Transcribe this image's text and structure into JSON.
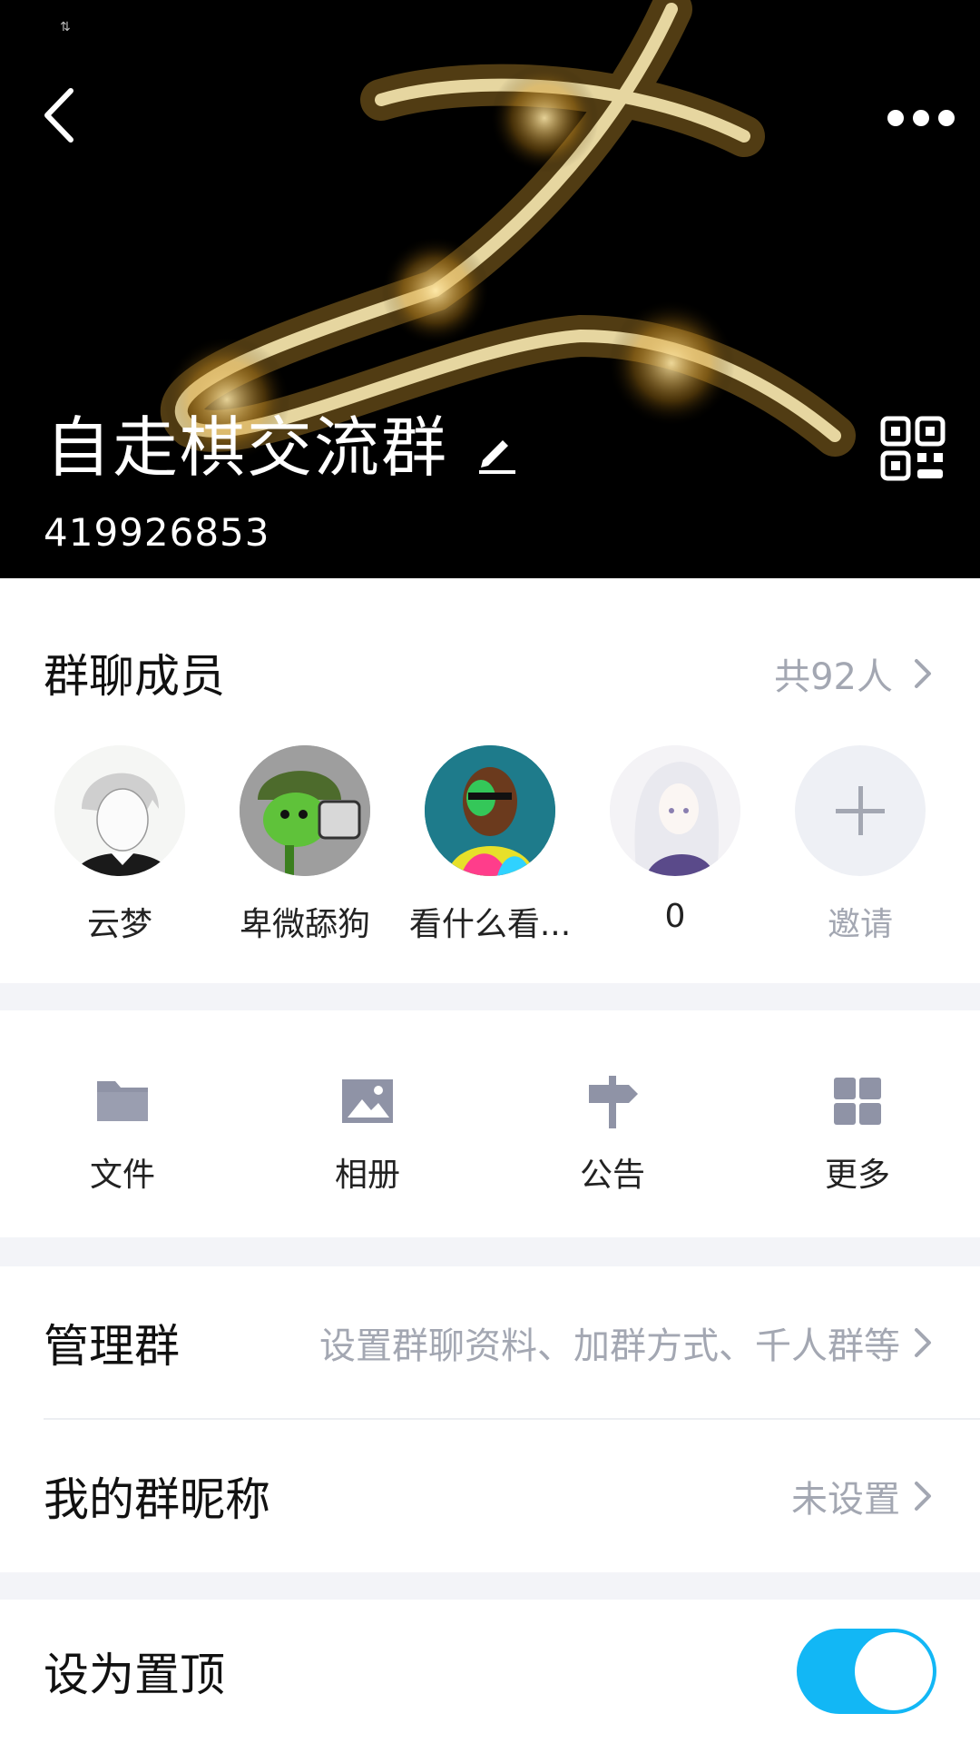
{
  "header": {
    "status_text": "⇅",
    "group_name": "自走棋交流群",
    "group_number": "419926853",
    "icons": [
      "back-arrow-icon",
      "more-dots-icon",
      "edit-pencil-icon",
      "qr-code-icon"
    ]
  },
  "members": {
    "title": "群聊成员",
    "count_label": "共92人",
    "list": [
      {
        "name": "云梦",
        "avatar": "anime-man-avatar"
      },
      {
        "name": "卑微舔狗",
        "avatar": "peashooter-avatar"
      },
      {
        "name": "看什么看...",
        "avatar": "colorful-portrait-avatar"
      },
      {
        "name": "0",
        "avatar": "white-hair-girl-avatar"
      }
    ],
    "invite_label": "邀请"
  },
  "tools": {
    "items": [
      {
        "label": "文件",
        "icon": "folder-icon"
      },
      {
        "label": "相册",
        "icon": "image-icon"
      },
      {
        "label": "公告",
        "icon": "signpost-icon"
      },
      {
        "label": "更多",
        "icon": "grid-icon"
      }
    ]
  },
  "settings": {
    "manage": {
      "title": "管理群",
      "value": "设置群聊资料、加群方式、千人群等"
    },
    "nickname": {
      "title": "我的群昵称",
      "value": "未设置"
    },
    "pin": {
      "title": "设为置顶",
      "enabled": true
    }
  },
  "colors": {
    "accent": "#12b7f5",
    "secondary_text": "#a3a7b2",
    "icon_gray": "#8f93a6",
    "gap": "#f3f4f8"
  }
}
